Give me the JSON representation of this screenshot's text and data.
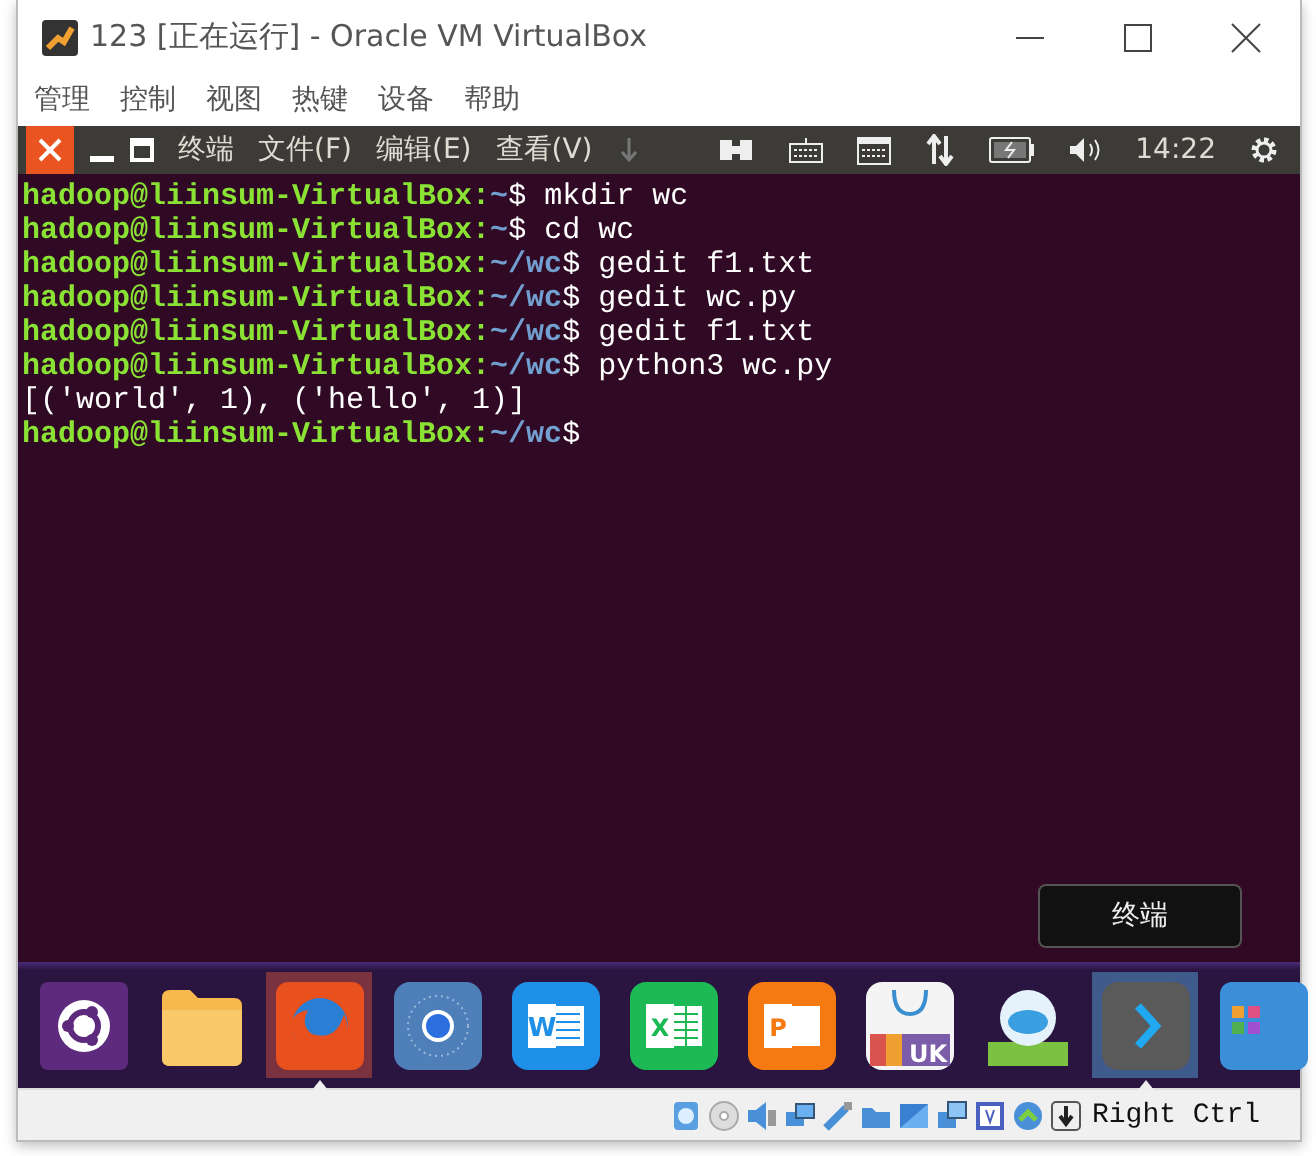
{
  "window": {
    "title": "123 [正在运行] - Oracle VM VirtualBox"
  },
  "menu": [
    "管理",
    "控制",
    "视图",
    "热键",
    "设备",
    "帮助"
  ],
  "guest_panel": {
    "menus": [
      "终端",
      "文件(F)",
      "编辑(E)",
      "查看(V)"
    ],
    "clock": "14:22"
  },
  "terminal": {
    "lines": [
      {
        "kind": "prompt",
        "user": "hadoop@liinsum-VirtualBox:",
        "path": "~",
        "sigil": "$",
        "command": "mkdir wc"
      },
      {
        "kind": "prompt",
        "user": "hadoop@liinsum-VirtualBox:",
        "path": "~",
        "sigil": "$",
        "command": "cd wc"
      },
      {
        "kind": "prompt",
        "user": "hadoop@liinsum-VirtualBox:",
        "path": "~/wc",
        "sigil": "$",
        "command": "gedit f1.txt"
      },
      {
        "kind": "prompt",
        "user": "hadoop@liinsum-VirtualBox:",
        "path": "~/wc",
        "sigil": "$",
        "command": "gedit wc.py"
      },
      {
        "kind": "prompt",
        "user": "hadoop@liinsum-VirtualBox:",
        "path": "~/wc",
        "sigil": "$",
        "command": "gedit f1.txt"
      },
      {
        "kind": "prompt",
        "user": "hadoop@liinsum-VirtualBox:",
        "path": "~/wc",
        "sigil": "$",
        "command": "python3 wc.py"
      },
      {
        "kind": "output",
        "text": "[('world', 1), ('hello', 1)]"
      },
      {
        "kind": "prompt",
        "user": "hadoop@liinsum-VirtualBox:",
        "path": "~/wc",
        "sigil": "$"
      }
    ]
  },
  "launcher": {
    "tooltip": "终端",
    "items": [
      {
        "kind": "ubuntu",
        "running": false,
        "selected": false
      },
      {
        "kind": "files",
        "running": false,
        "selected": false
      },
      {
        "kind": "firefox",
        "running": true,
        "selected": false
      },
      {
        "kind": "chromium",
        "running": false,
        "selected": false
      },
      {
        "kind": "word",
        "glyph": "W",
        "running": false,
        "selected": false
      },
      {
        "kind": "excel",
        "glyph": "X",
        "running": false,
        "selected": false
      },
      {
        "kind": "slides",
        "glyph": "P",
        "running": false,
        "selected": false
      },
      {
        "kind": "store",
        "glyph": "UK",
        "running": false,
        "selected": false
      },
      {
        "kind": "kylin",
        "running": false,
        "selected": false
      },
      {
        "kind": "terminal",
        "running": true,
        "selected": true
      },
      {
        "kind": "apps",
        "running": false,
        "selected": false
      }
    ]
  },
  "status_bar": {
    "host_key": "Right Ctrl"
  }
}
